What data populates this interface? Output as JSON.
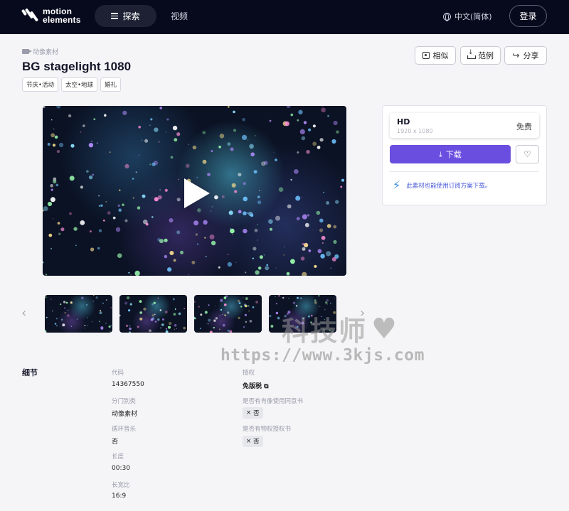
{
  "nav": {
    "logo_line1": "motion",
    "logo_line2": "elements",
    "explore_label": "探索",
    "video_label": "视频",
    "language": "中文(简体)",
    "login_label": "登录"
  },
  "asset": {
    "category": "动像素材",
    "title": "BG stagelight 1080",
    "tags": [
      "节庆•活动",
      "太空•地球",
      "婚礼"
    ]
  },
  "actions": {
    "similar_label": "相似",
    "sample_label": "范例",
    "share_label": "分享"
  },
  "purchase": {
    "resolution_name": "HD",
    "resolution_dims": "1920 x 1080",
    "price": "免费",
    "download_label": "下载",
    "promo_text": "此素材也能使用订阅方案下载。"
  },
  "watermark": {
    "line1": "科技师",
    "line2": "https://www.3kjs.com"
  },
  "details": {
    "heading": "细节",
    "code_label": "代码",
    "code_value": "14367550",
    "category_label": "分门别类",
    "category_value": "动像素材",
    "loop_label": "循环音乐",
    "loop_value": "否",
    "length_label": "长度",
    "length_value": "00:30",
    "aspect_label": "长宽比",
    "aspect_value": "16:9",
    "license_label": "授权",
    "license_value": "免版税",
    "model_release_label": "是否有肖像使用同意书",
    "model_release_value": "否",
    "property_release_label": "是否有物权授权书",
    "property_release_value": "否"
  },
  "colors": {
    "nav_bg": "#070a1c",
    "accent": "#6a4ee0",
    "promo_text": "#4a5bd8"
  }
}
